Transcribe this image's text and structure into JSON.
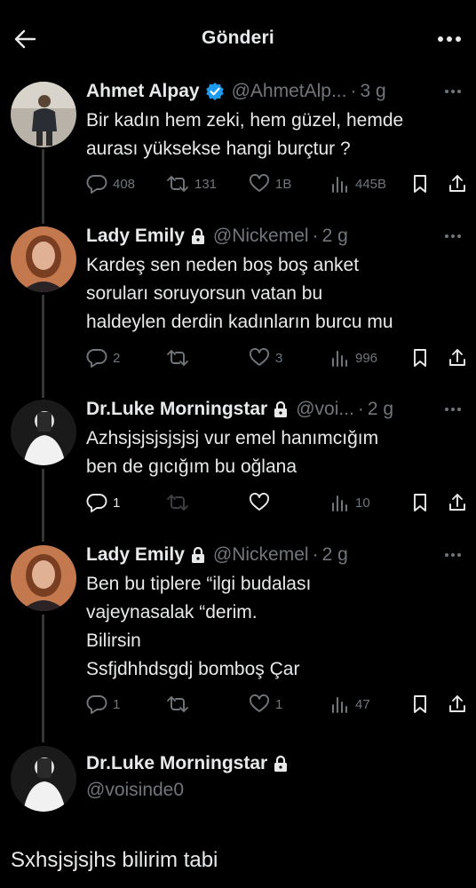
{
  "header": {
    "title": "Gönderi"
  },
  "tweets": [
    {
      "name": "Ahmet Alpay",
      "handle": "@AhmetAlp...",
      "time": "3 g",
      "verified": true,
      "locked": false,
      "lines": [
        "Bir kadın hem zeki, hem güzel, hemde",
        "aurası yüksekse hangi burçtur ?"
      ],
      "replies": "408",
      "reposts": "131",
      "likes": "1B",
      "views": "445B"
    },
    {
      "name": "Lady Emily",
      "handle": "@Nickemel",
      "time": "2 g",
      "verified": false,
      "locked": true,
      "lines": [
        "Kardeş sen neden  boş boş anket",
        "soruları soruyorsun vatan bu",
        "haldeylen derdin kadınların burcu mu"
      ],
      "replies": "2",
      "reposts": "",
      "likes": "3",
      "views": "996"
    },
    {
      "name": "Dr.Luke Morningstar",
      "handle": "@voi...",
      "time": "2 g",
      "verified": false,
      "locked": true,
      "lines": [
        "Azhsjsjsjsjsjsj vur emel hanımcığım",
        "ben de gıcığım bu oğlana"
      ],
      "replies": "1",
      "reposts": "",
      "likes": "",
      "views": "10"
    },
    {
      "name": "Lady Emily",
      "handle": "@Nickemel",
      "time": "2 g",
      "verified": false,
      "locked": true,
      "lines": [
        "Ben bu tiplere “ilgi budalası",
        "vajeynasalak “derim.",
        "Bilirsin",
        "Ssfjdhhdsgdj bomboş Çar"
      ],
      "replies": "1",
      "reposts": "",
      "likes": "1",
      "views": "47"
    }
  ],
  "reply": {
    "name": "Dr.Luke Morningstar",
    "handle": "@voisinde0",
    "text": "Sxhsjsjsjhs bilirim tabi"
  },
  "colors": {
    "background": "#000000",
    "text": "#e7e9ea",
    "muted": "#71767b",
    "verified": "#1d9bf0",
    "thread_line": "#333639"
  }
}
